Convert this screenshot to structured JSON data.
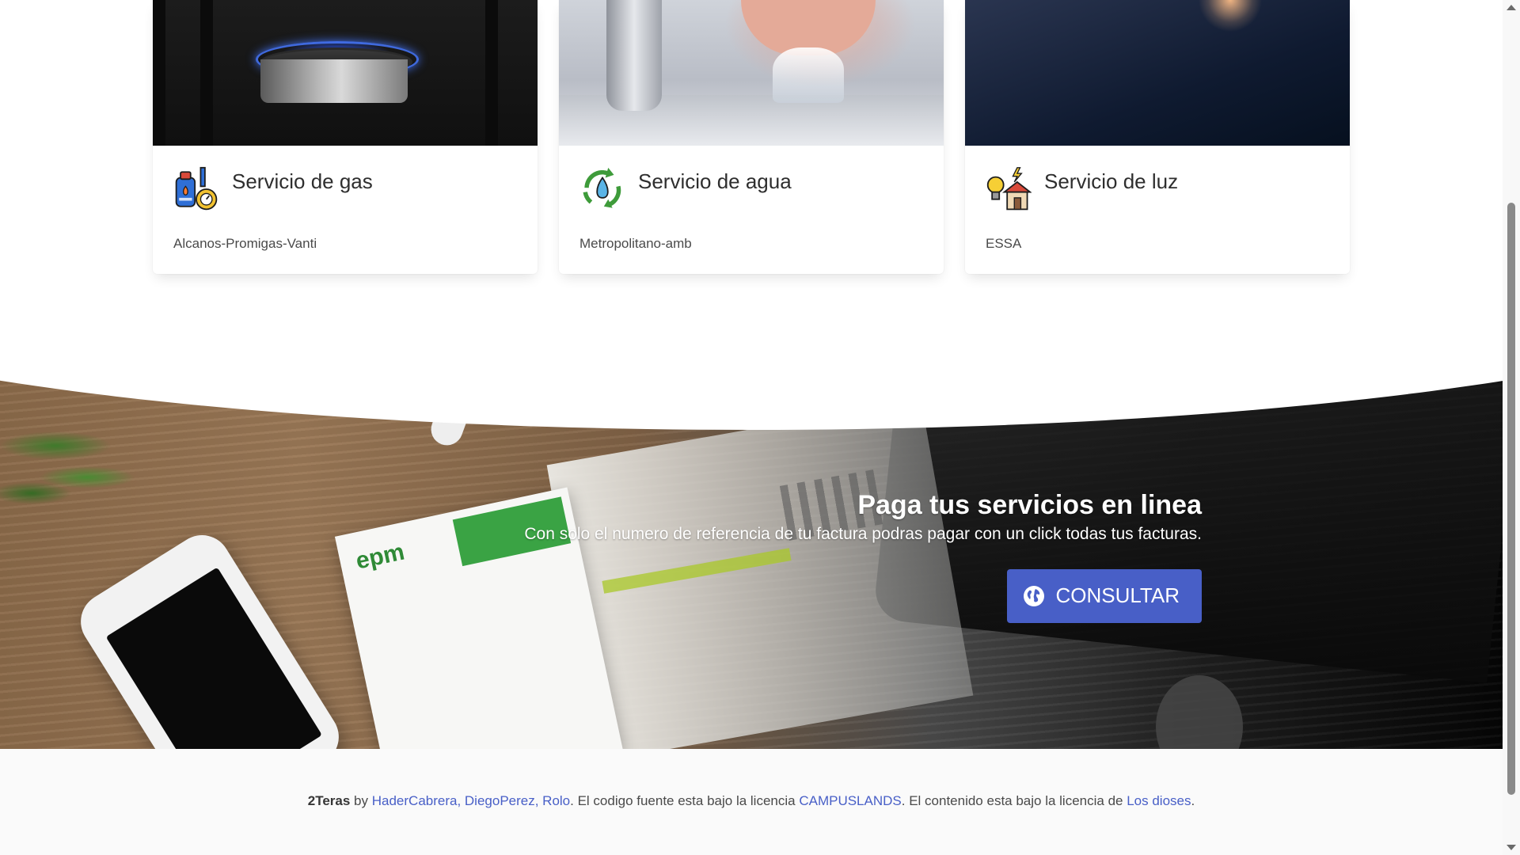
{
  "services": [
    {
      "title": "Servicio de gas",
      "provider": "Alcanos-Promigas-Vanti",
      "icon": "gas-cylinder-icon"
    },
    {
      "title": "Servicio de agua",
      "provider": "Metropolitano-amb",
      "icon": "water-recycle-icon"
    },
    {
      "title": "Servicio de luz",
      "provider": "ESSA",
      "icon": "house-lightbulb-icon"
    }
  ],
  "banner": {
    "title": "Paga tus servicios en linea",
    "text": "Con solo el numero de referencia de tu factura podras pagar con un click todas tus facturas.",
    "button_label": "CONSULTAR",
    "button_icon": "globe-icon",
    "bill_logo": "epm"
  },
  "footer": {
    "brand": "2Teras",
    "by": " by ",
    "authors_link": "HaderCabrera, DiegoPerez, Rolo",
    "text_source": ". El codigo fuente esta bajo la licencia ",
    "source_license_link": "CAMPUSLANDS",
    "text_content": ". El contenido esta bajo la licencia de ",
    "content_license_link": "Los dioses",
    "end": "."
  },
  "colors": {
    "primary": "#485fc7",
    "footer_bg": "#fafafa",
    "text": "#4a4a4a"
  }
}
